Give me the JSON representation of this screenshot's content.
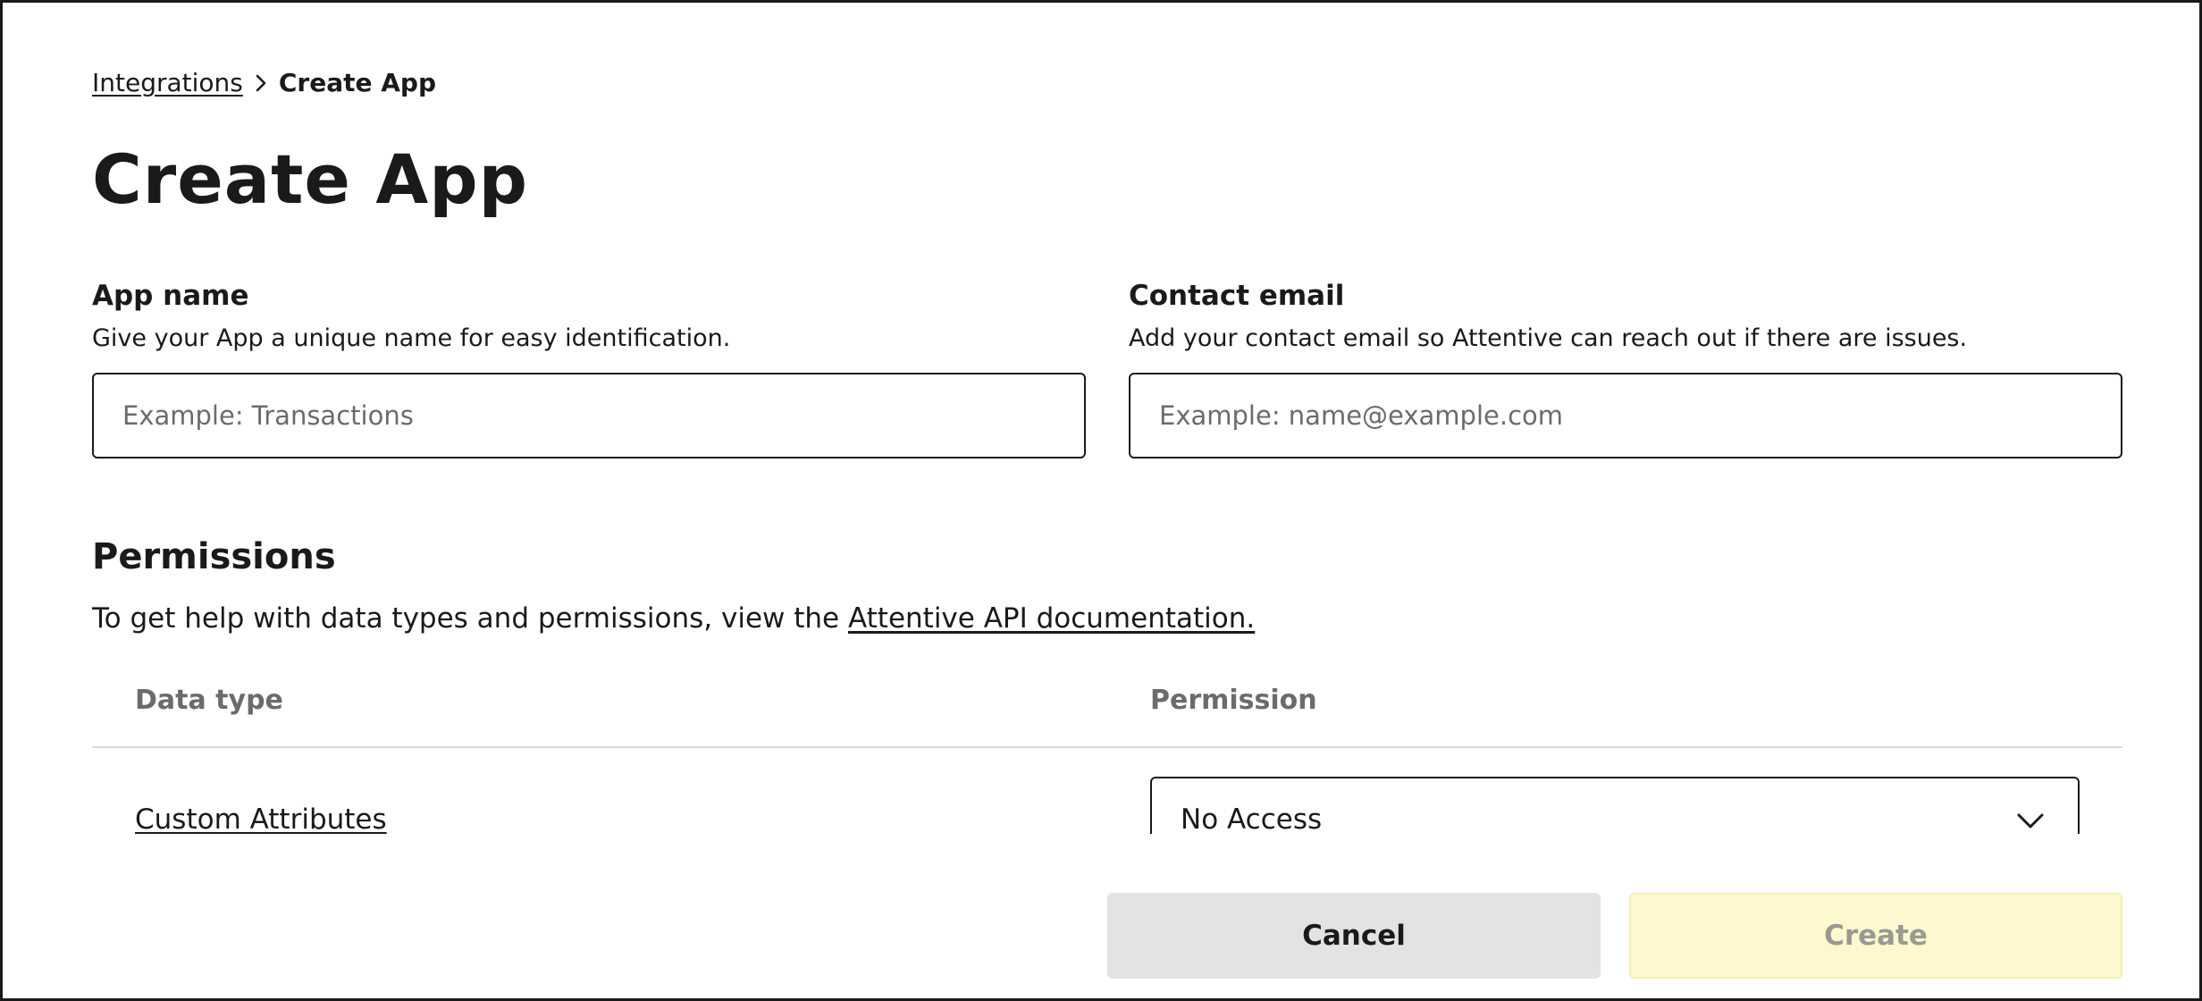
{
  "breadcrumb": {
    "parent": "Integrations",
    "current": "Create App"
  },
  "page": {
    "title": "Create App"
  },
  "form": {
    "app_name": {
      "label": "App name",
      "help": "Give your App a unique name for easy identification.",
      "value": "",
      "placeholder": "Example: Transactions"
    },
    "contact_email": {
      "label": "Contact email",
      "help": "Add your contact email so Attentive can reach out if there are issues.",
      "value": "",
      "placeholder": "Example: name@example.com"
    }
  },
  "permissions": {
    "title": "Permissions",
    "help_prefix": "To get help with data types and permissions, view the ",
    "help_link": "Attentive API documentation.",
    "columns": {
      "data_type": "Data type",
      "permission": "Permission"
    },
    "rows": [
      {
        "data_type": "Custom Attributes",
        "permission": "No Access"
      }
    ]
  },
  "footer": {
    "cancel_label": "Cancel",
    "create_label": "Create"
  },
  "icons": {
    "breadcrumb_separator": "chevron-right-icon",
    "select_toggle": "chevron-down-icon"
  },
  "colors": {
    "text": "#1a1a1a",
    "muted": "#6b6b6b",
    "cancel_bg": "#e2e3e3",
    "create_disabled_bg": "#fdf8cf",
    "divider": "#dcdcdc"
  }
}
